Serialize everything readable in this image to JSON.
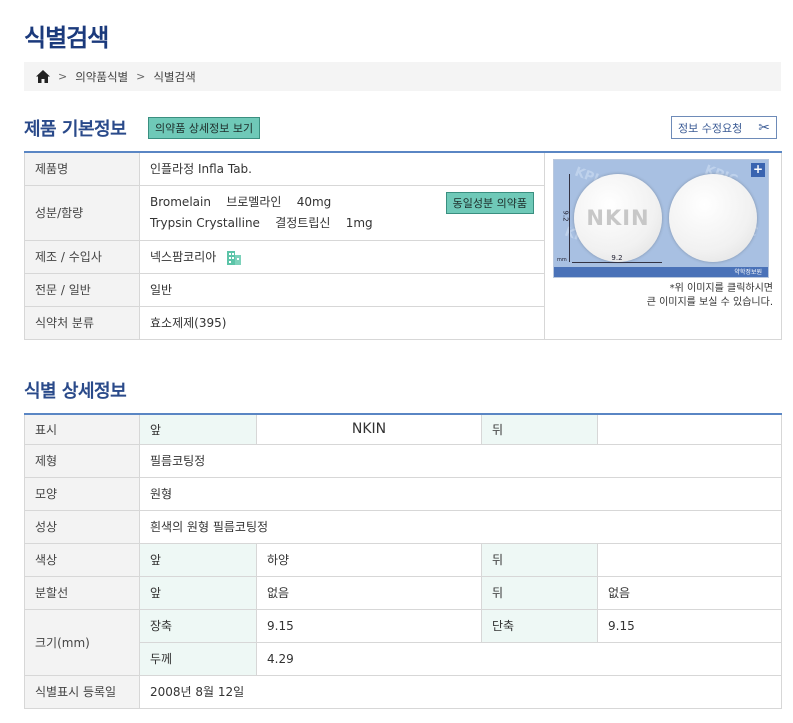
{
  "page_title": "식별검색",
  "breadcrumb": {
    "items": [
      "의약품식별",
      "식별검색"
    ]
  },
  "basic": {
    "section_title": "제품 기본정보",
    "detail_button": "의약품 상세정보 보기",
    "edit_button": "정보 수정요청",
    "rows": {
      "product_label": "제품명",
      "product_value": "인플라정 Infla Tab.",
      "ingredient_label": "성분/함량",
      "ingredients": [
        {
          "name": "Bromelain",
          "korean": "브로멜라인",
          "amount": "40mg"
        },
        {
          "name": "Trypsin Crystalline",
          "korean": "결정트립신",
          "amount": "1mg"
        }
      ],
      "same_ingredient_button": "동일성분 의약품",
      "maker_label": "제조 / 수입사",
      "maker_value": "넥스팜코리아",
      "type_label": "전문 / 일반",
      "type_value": "일반",
      "category_label": "식약처 분류",
      "category_value": "효소제제(395)"
    },
    "photo": {
      "imprint": "NKIN",
      "dim_width": "9.2",
      "dim_height": "9.2",
      "unit": "mm",
      "watermark": "KPIC",
      "bar_text": "약학정보원",
      "note_line1": "*위 이미지를 클릭하시면",
      "note_line2": "큰 이미지를 보실 수 있습니다."
    }
  },
  "ident": {
    "section_title": "식별 상세정보",
    "display_label": "표시",
    "front": "앞",
    "back": "뒤",
    "display_front_value": "NKIN",
    "display_back_value": "",
    "form_label": "제형",
    "form_value": "필름코팅정",
    "shape_label": "모양",
    "shape_value": "원형",
    "property_label": "성상",
    "property_value": "흰색의 원형 필름코팅정",
    "color_label": "색상",
    "color_front": "하양",
    "color_back": "",
    "score_label": "분할선",
    "score_front": "없음",
    "score_back": "없음",
    "size_label": "크기(mm)",
    "long_label": "장축",
    "long_value": "9.15",
    "short_label": "단축",
    "short_value": "9.15",
    "thick_label": "두께",
    "thick_value": "4.29",
    "date_label": "식별표시 등록일",
    "date_value": "2008년 8월 12일"
  }
}
